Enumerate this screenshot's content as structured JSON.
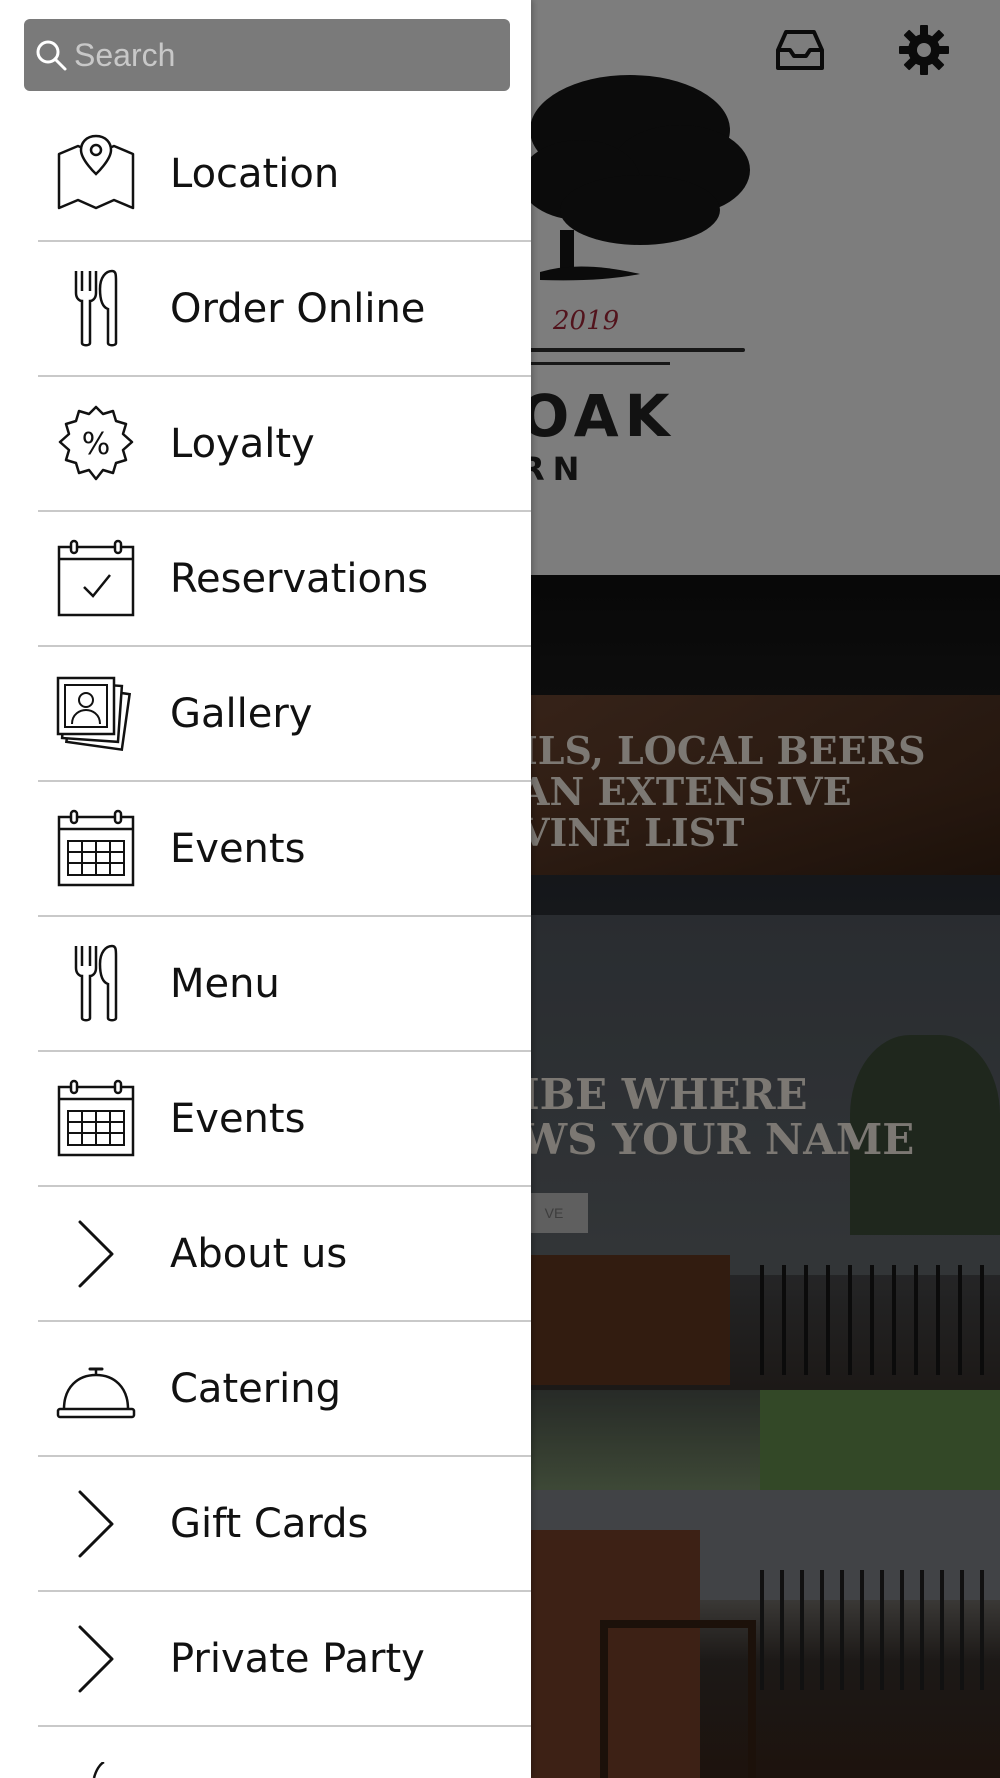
{
  "background": {
    "logo": {
      "year": "2019",
      "name": "OAK",
      "subtitle": "RN"
    },
    "banner1_text": "ILS, LOCAL BEERS\nAN EXTENSIVE\nVINE LIST",
    "banner2_text": "IBE WHERE\nWS YOUR NAME",
    "banner2_button": "VE",
    "icons": [
      "inbox-icon",
      "gear-icon"
    ]
  },
  "drawer": {
    "search": {
      "placeholder": "Search",
      "value": ""
    },
    "items": [
      {
        "label": "Location",
        "icon": "map-pin-icon"
      },
      {
        "label": "Order Online",
        "icon": "fork-knife-icon"
      },
      {
        "label": "Loyalty",
        "icon": "percent-badge-icon"
      },
      {
        "label": "Reservations",
        "icon": "calendar-check-icon"
      },
      {
        "label": "Gallery",
        "icon": "photo-stack-icon"
      },
      {
        "label": "Events",
        "icon": "calendar-grid-icon"
      },
      {
        "label": "Menu",
        "icon": "fork-knife-icon"
      },
      {
        "label": "Events",
        "icon": "calendar-grid-icon"
      },
      {
        "label": "About us",
        "icon": "chevron-right-icon"
      },
      {
        "label": "Catering",
        "icon": "cloche-icon"
      },
      {
        "label": "Gift Cards",
        "icon": "chevron-right-icon"
      },
      {
        "label": "Private Party",
        "icon": "chevron-right-icon"
      }
    ]
  },
  "colors": {
    "drawer_bg": "#ffffff",
    "search_bg": "#7a7a7a",
    "text": "#111111",
    "divider": "#c9c9c9"
  }
}
